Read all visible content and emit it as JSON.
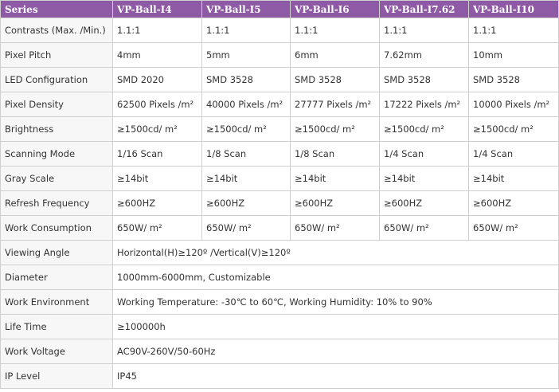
{
  "colors": {
    "header_bg": "#8e5aa6",
    "header_text": "#ffffff",
    "border": "#cfcfcf",
    "label_bg": "#f7f7f7",
    "text": "#333333"
  },
  "headers": [
    "Series",
    "VP-Ball-I4",
    "VP-Ball-I5",
    "VP-Ball-I6",
    "VP-Ball-I7.62",
    "VP-Ball-I10"
  ],
  "rows": [
    {
      "label": "Contrasts (Max. /Min.)",
      "values": [
        "1.1:1",
        "1.1:1",
        "1.1:1",
        "1.1:1",
        "1.1:1"
      ]
    },
    {
      "label": "Pixel Pitch",
      "values": [
        "4mm",
        "5mm",
        "6mm",
        "7.62mm",
        "10mm"
      ]
    },
    {
      "label": "LED Configuration",
      "values": [
        "SMD 2020",
        "SMD 3528",
        "SMD 3528",
        "SMD 3528",
        "SMD 3528"
      ]
    },
    {
      "label": "Pixel Density",
      "values": [
        "62500 Pixels /m²",
        "40000 Pixels /m²",
        "27777 Pixels /m²",
        "17222 Pixels /m²",
        "10000 Pixels /m²"
      ]
    },
    {
      "label": "Brightness",
      "values": [
        "≥1500cd/ m²",
        "≥1500cd/ m²",
        "≥1500cd/ m²",
        "≥1500cd/ m²",
        "≥1500cd/ m²"
      ]
    },
    {
      "label": "Scanning Mode",
      "values": [
        "1/16 Scan",
        "1/8 Scan",
        "1/8 Scan",
        "1/4 Scan",
        "1/4 Scan"
      ]
    },
    {
      "label": "Gray Scale",
      "values": [
        "≥14bit",
        "≥14bit",
        "≥14bit",
        "≥14bit",
        "≥14bit"
      ]
    },
    {
      "label": "Refresh Frequency",
      "values": [
        "≥600HZ",
        "≥600HZ",
        "≥600HZ",
        "≥600HZ",
        "≥600HZ"
      ]
    },
    {
      "label": "Work Consumption",
      "values": [
        "650W/ m²",
        "650W/ m²",
        "650W/ m²",
        "650W/ m²",
        "650W/ m²"
      ]
    }
  ],
  "merged_rows": [
    {
      "label": "Viewing Angle",
      "value": "Horizontal(H)≥120º /Vertical(V)≥120º"
    },
    {
      "label": "Diameter",
      "value": "1000mm-6000mm, Customizable"
    },
    {
      "label": "Work Environment",
      "value": "Working Temperature: -30℃ to 60℃, Working Humidity: 10% to 90%"
    },
    {
      "label": "Life Time",
      "value": "≥100000h"
    },
    {
      "label": "Work Voltage",
      "value": "AC90V-260V/50-60Hz"
    },
    {
      "label": "IP Level",
      "value": "IP45"
    }
  ]
}
